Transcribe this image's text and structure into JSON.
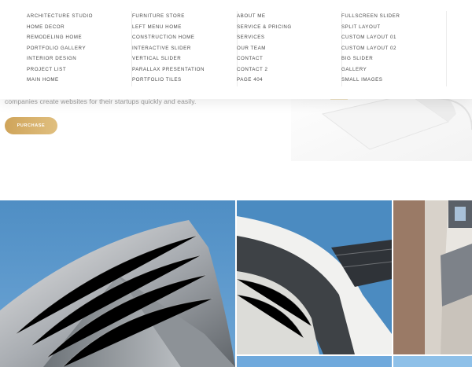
{
  "menu": {
    "columns": [
      {
        "items": [
          "ARCHITECTURE STUDIO",
          "HOME DECOR",
          "REMODELING HOME",
          "PORTFOLIO GALLERY",
          "INTERIOR DESIGN",
          "PROJECT LIST",
          "MAIN HOME"
        ]
      },
      {
        "items": [
          "FURNITURE STORE",
          "LEFT MENU HOME",
          "CONSTRUCTION HOME",
          "INTERACTIVE SLIDER",
          "VERTICAL SLIDER",
          "PARALLAX PRESENTATION",
          "PORTFOLIO TILES"
        ]
      },
      {
        "items": [
          "ABOUT ME",
          "SERVICE & PRICING",
          "SERVICES",
          "OUR TEAM",
          "CONTACT",
          "CONTACT 2",
          "PAGE 404"
        ]
      },
      {
        "items": [
          "FULLSCREEN SLIDER",
          "SPLIT LAYOUT",
          "CUSTOM LAYOUT 01",
          "CUSTOM LAYOUT 02",
          "BIG SLIDER",
          "GALLERY",
          "SMALL IMAGES"
        ]
      }
    ]
  },
  "hero": {
    "text": "companies create websites for their startups quickly and easily.",
    "button_label": "PURCHASE"
  },
  "colors": {
    "accent_gold": "#d4aa63",
    "sky_blue": "#4d8fc6",
    "menu_text": "#4a4a4a"
  }
}
